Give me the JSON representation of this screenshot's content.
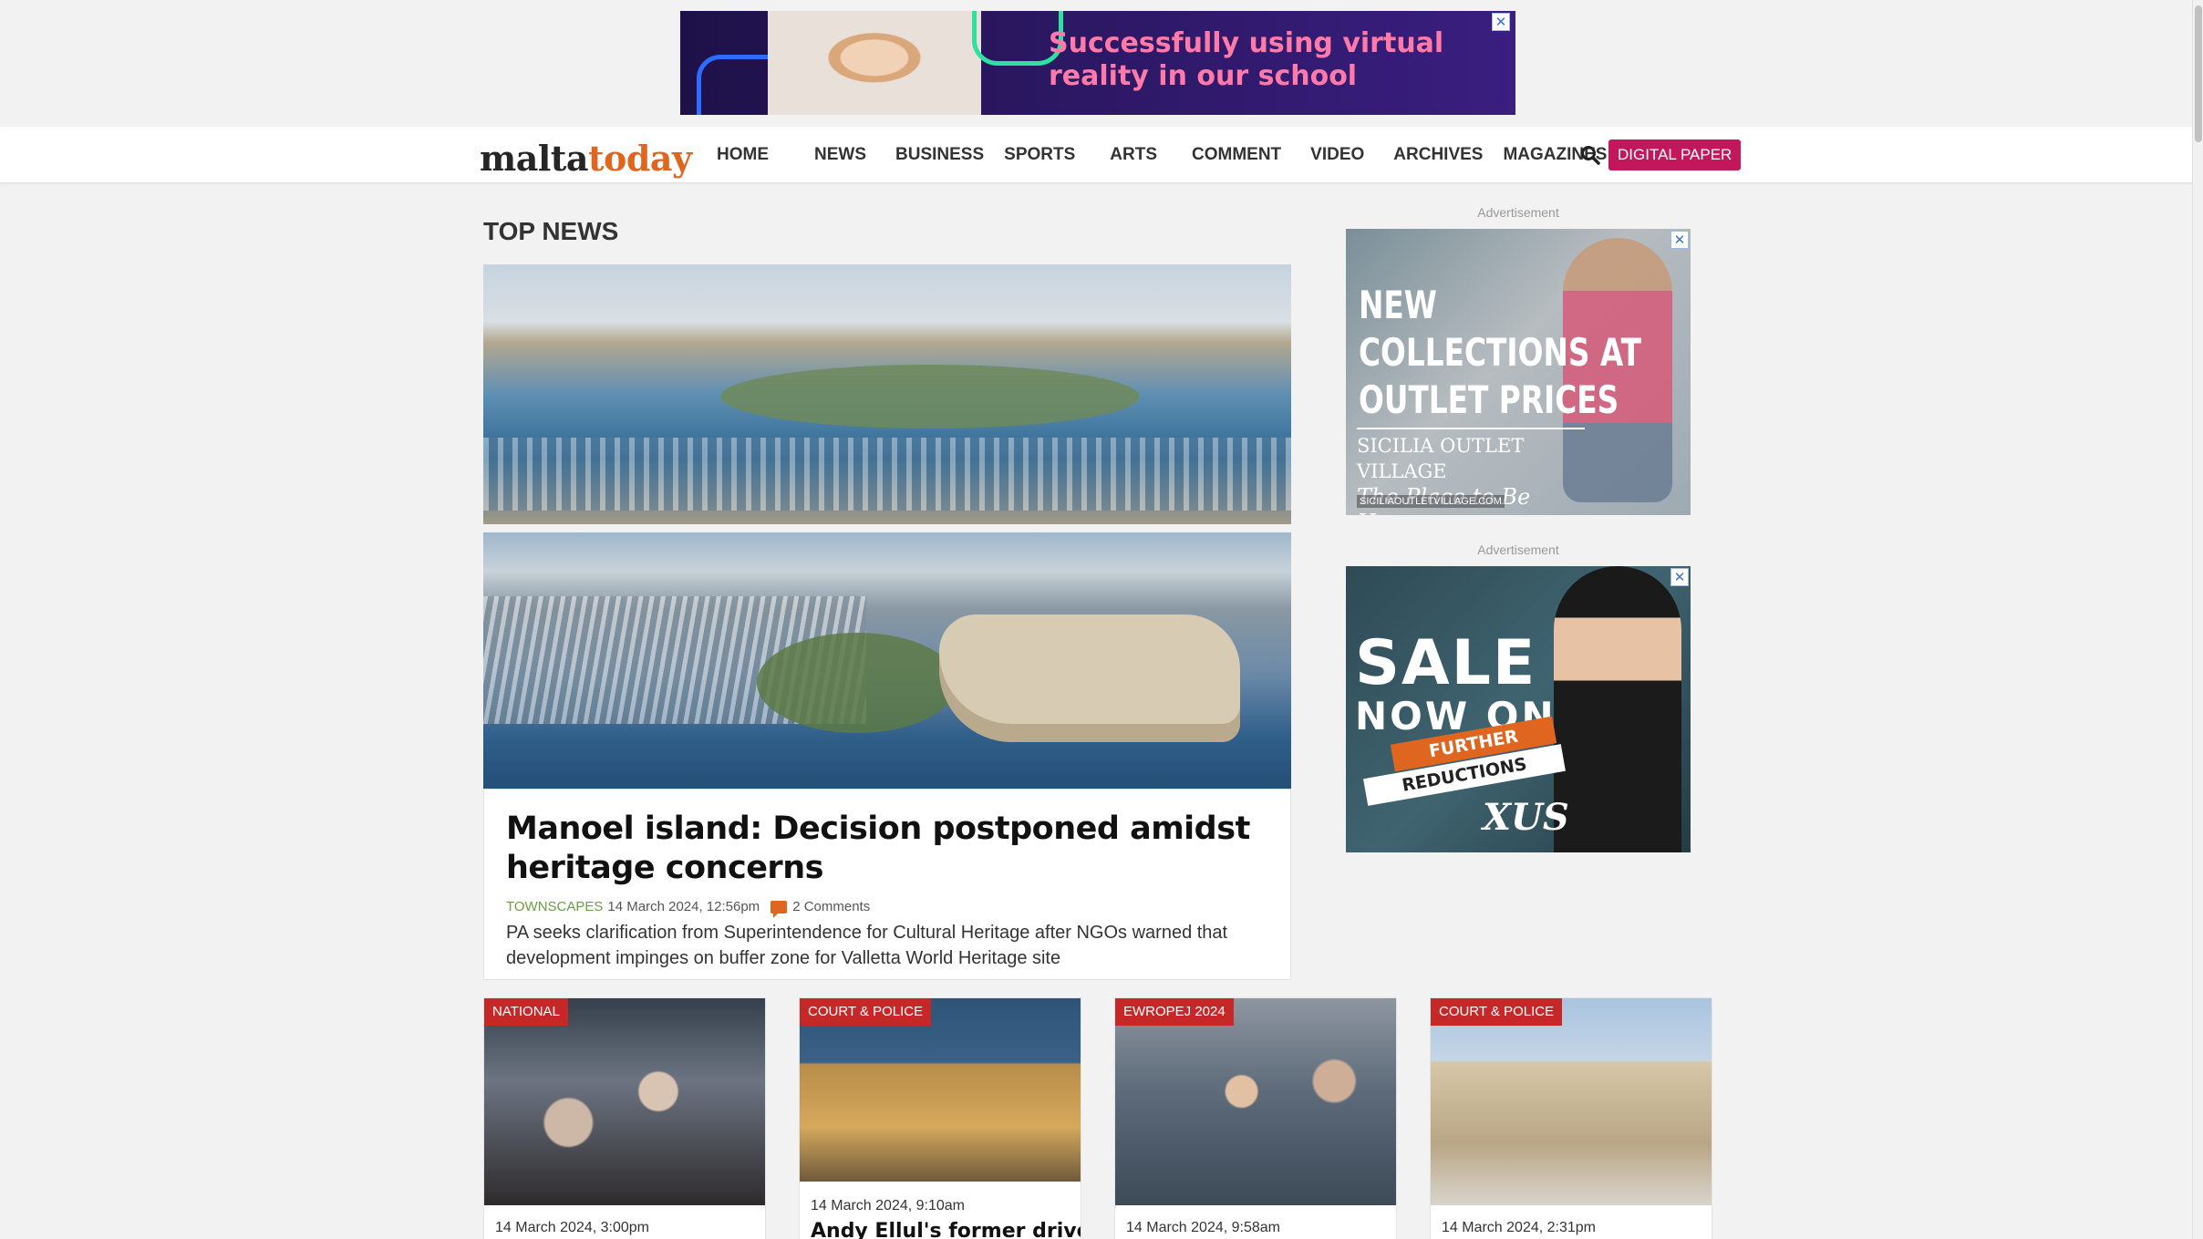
{
  "top_ad": {
    "headline": "Successfully using virtual reality in our school",
    "close": "✕"
  },
  "navbar": {
    "logo_part1": "malta",
    "logo_part2": "today",
    "menu": [
      "HOME",
      "NEWS",
      "BUSINESS",
      "SPORTS",
      "ARTS",
      "COMMENT",
      "VIDEO",
      "ARCHIVES",
      "MAGAZINES"
    ],
    "search_icon": "search-icon",
    "digital_paper": "DIGITAL PAPER"
  },
  "top_news": {
    "section_title": "TOP NEWS",
    "hero": {
      "title": "Manoel island: Decision postponed amidst heritage concerns",
      "category": "TOWNSCAPES",
      "date": "14 March 2024, 12:56pm",
      "comments": "2 Comments",
      "summary": "PA seeks clarification from Superintendence for Cultural Heritage after NGOs warned that development impinges on buffer zone for Valletta World Heritage site"
    }
  },
  "sidebar": {
    "ad1": {
      "label": "Advertisement",
      "headline": "NEW COLLECTIONS AT OUTLET PRICES",
      "brand": "SICILIA OUTLET VILLAGE",
      "tagline": "The Place to Be Happy",
      "url": "SICILIAOUTLETVILLAGE.COM"
    },
    "ad2": {
      "label": "Advertisement",
      "sale": "SALE",
      "now_on": "NOW ON",
      "further": "FURTHER",
      "reductions": "REDUCTIONS",
      "brand": "XUS"
    }
  },
  "cards": [
    {
      "badge": "NATIONAL",
      "date": "14 March 2024, 3:00pm",
      "title": ""
    },
    {
      "badge": "COURT & POLICE",
      "date": "14 March 2024, 9:10am",
      "title": "Andy Ellul's former driver"
    },
    {
      "badge": "EWROPEJ 2024",
      "date": "14 March 2024, 9:58am",
      "title": ""
    },
    {
      "badge": "COURT & POLICE",
      "date": "14 March 2024, 2:31pm",
      "title": ""
    }
  ],
  "colors": {
    "accent_orange": "#e0661f",
    "digital_paper_bg": "#c2185b",
    "badge_red": "#c62828",
    "category_green": "#6b9e42"
  }
}
